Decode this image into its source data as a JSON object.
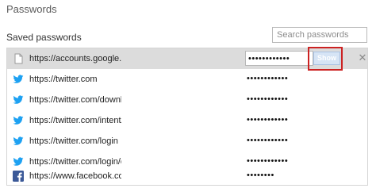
{
  "dialog": {
    "title": "Passwords",
    "section_label": "Saved passwords",
    "search": {
      "placeholder": "Search passwords",
      "value": ""
    }
  },
  "rows": [
    {
      "url": "https://accounts.google.com",
      "password": "••••••••••••",
      "icon": "page-icon",
      "selected": true,
      "show_label": "Show",
      "remove_label": "✕"
    },
    {
      "url": "https://twitter.com",
      "password": "••••••••••••",
      "icon": "twitter-icon"
    },
    {
      "url": "https://twitter.com/download",
      "password": "••••••••••••",
      "icon": "twitter-icon"
    },
    {
      "url": "https://twitter.com/intent/tweet",
      "password": "••••••••••••",
      "icon": "twitter-icon"
    },
    {
      "url": "https://twitter.com/login",
      "password": "••••••••••••",
      "icon": "twitter-icon"
    },
    {
      "url": "https://twitter.com/login/error",
      "password": "••••••••••••",
      "icon": "twitter-icon"
    },
    {
      "url": "https://www.facebook.com/",
      "password": "••••••••",
      "icon": "facebook-icon"
    }
  ],
  "colors": {
    "selected_row": "#dcdcdc",
    "twitter": "#1da1f2",
    "facebook": "#3b5998",
    "highlight": "#cc2222"
  }
}
